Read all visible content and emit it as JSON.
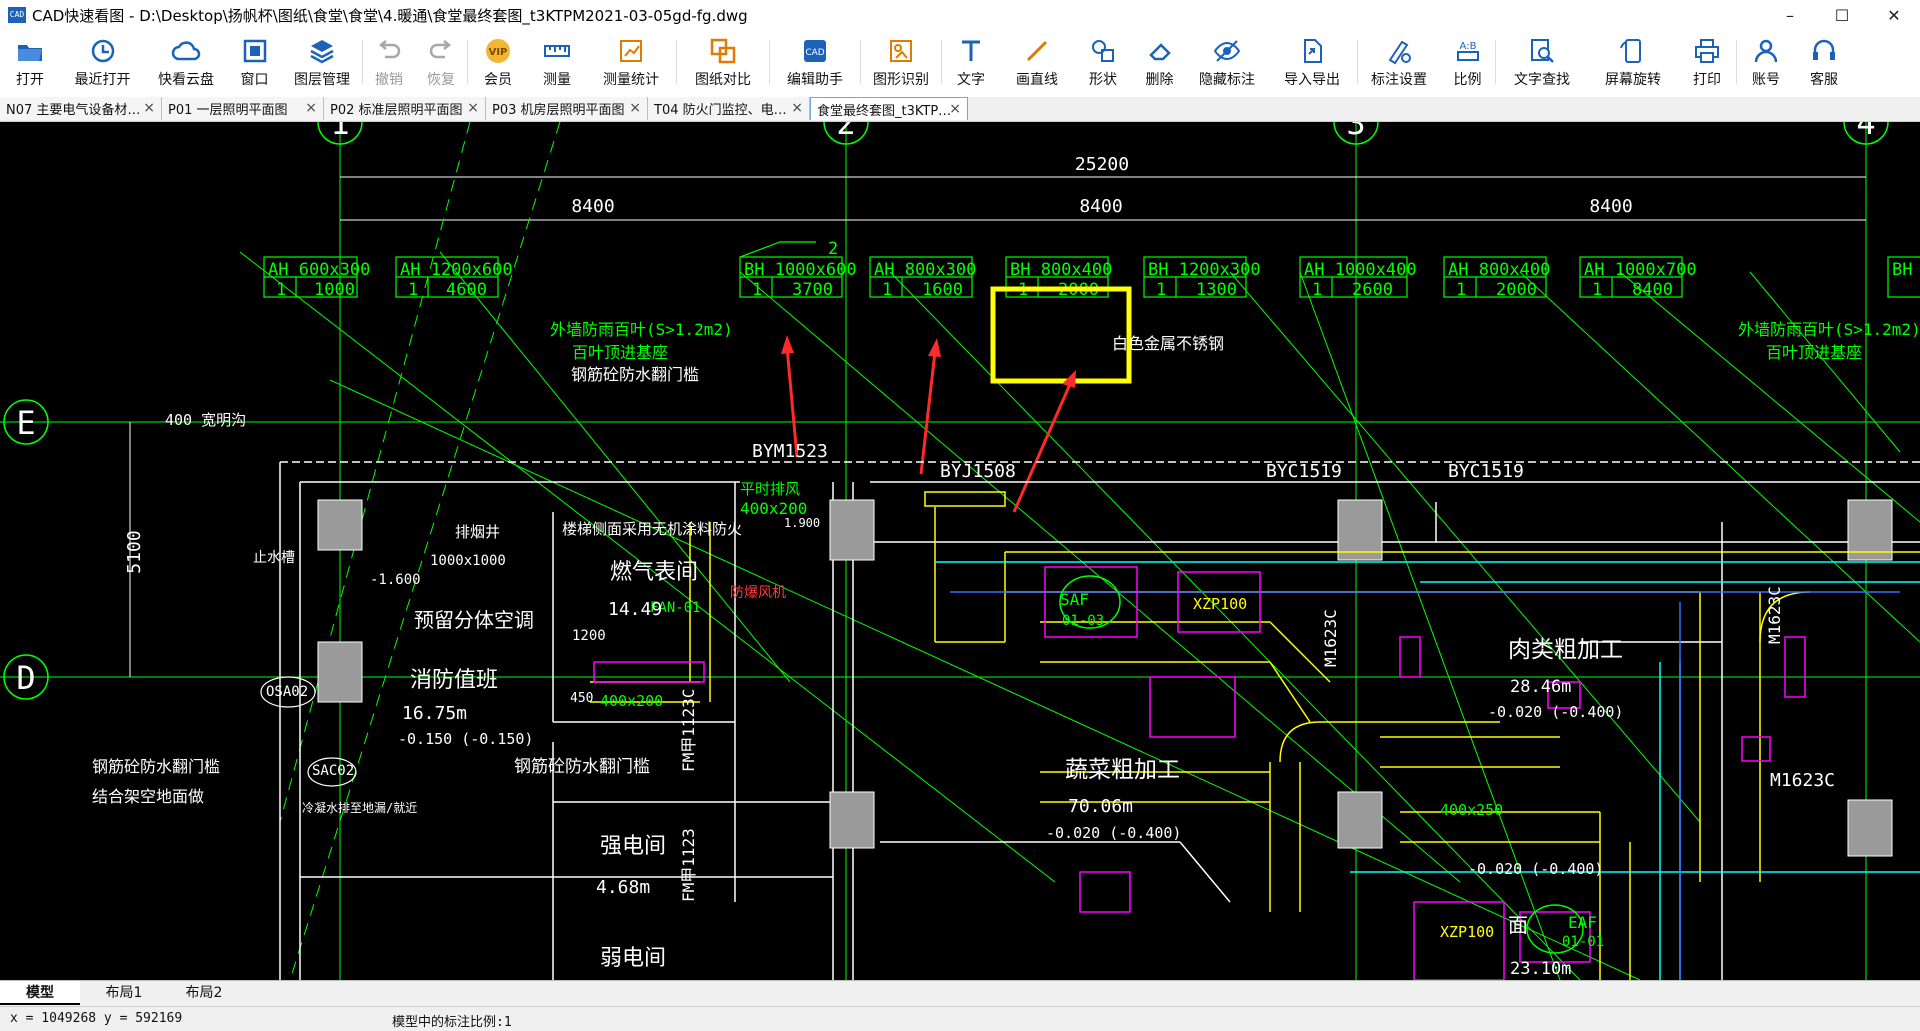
{
  "window": {
    "title": "CAD快速看图 - D:\\Desktop\\扬帆杯\\图纸\\食堂\\食堂\\4.暖通\\食堂最终套图_t3KTPM2021-03-05gd-fg.dwg",
    "app_icon_text": "CAD",
    "minimize": "–",
    "maximize": "☐",
    "close": "✕"
  },
  "toolbar": {
    "items": [
      {
        "label": "打开",
        "icon": "folder-open-icon",
        "enabled": true
      },
      {
        "label": "最近打开",
        "icon": "clock-history-icon",
        "enabled": true
      },
      {
        "label": "快看云盘",
        "icon": "cloud-icon",
        "enabled": true
      },
      {
        "label": "窗口",
        "icon": "window-icon",
        "enabled": true
      },
      {
        "label": "图层管理",
        "icon": "layers-icon",
        "enabled": true
      },
      {
        "label": "撤销",
        "icon": "undo-icon",
        "enabled": false
      },
      {
        "label": "恢复",
        "icon": "redo-icon",
        "enabled": false
      },
      {
        "label": "会员",
        "icon": "vip-icon",
        "enabled": true,
        "badge": "VIP"
      },
      {
        "label": "测量",
        "icon": "ruler-icon",
        "enabled": true
      },
      {
        "label": "测量统计",
        "icon": "measure-stats-icon",
        "enabled": true
      },
      {
        "label": "图纸对比",
        "icon": "compare-icon",
        "enabled": true
      },
      {
        "label": "编辑助手",
        "icon": "edit-assistant-icon",
        "enabled": true
      },
      {
        "label": "图形识别",
        "icon": "shape-recognize-icon",
        "enabled": true
      },
      {
        "label": "文字",
        "icon": "text-icon",
        "enabled": true
      },
      {
        "label": "画直线",
        "icon": "line-icon",
        "enabled": true
      },
      {
        "label": "形状",
        "icon": "shape-icon",
        "enabled": true
      },
      {
        "label": "删除",
        "icon": "eraser-icon",
        "enabled": true
      },
      {
        "label": "隐藏标注",
        "icon": "hide-annotation-icon",
        "enabled": true
      },
      {
        "label": "导入导出",
        "icon": "import-export-icon",
        "enabled": true
      },
      {
        "label": "标注设置",
        "icon": "annotation-settings-icon",
        "enabled": true
      },
      {
        "label": "比例",
        "icon": "scale-icon",
        "enabled": true
      },
      {
        "label": "文字查找",
        "icon": "text-search-icon",
        "enabled": true
      },
      {
        "label": "屏幕旋转",
        "icon": "rotate-screen-icon",
        "enabled": true
      },
      {
        "label": "打印",
        "icon": "printer-icon",
        "enabled": true
      },
      {
        "label": "账号",
        "icon": "account-icon",
        "enabled": true
      },
      {
        "label": "客服",
        "icon": "headset-icon",
        "enabled": true
      }
    ]
  },
  "doc_tabs": [
    {
      "label": "N07 主要电气设备材…",
      "active": false
    },
    {
      "label": "P01 一层照明平面图",
      "active": false
    },
    {
      "label": "P02 标准层照明平面图",
      "active": false
    },
    {
      "label": "P03 机房层照明平面图",
      "active": false
    },
    {
      "label": "T04 防火门监控、电…",
      "active": false
    },
    {
      "label": "食堂最终套图_t3KTP…",
      "active": true
    }
  ],
  "tab_close": "×",
  "drawing": {
    "axes_top": [
      "1",
      "2",
      "3",
      "4"
    ],
    "axes_left": [
      "E",
      "D"
    ],
    "dim_total": "25200",
    "dim_spans": [
      "8400",
      "8400",
      "8400"
    ],
    "dim_vertical": "5100",
    "tag_rows": {
      "top": [
        "AH",
        "BH",
        "AH",
        "AH",
        "BH",
        "BH",
        "AH",
        "AH",
        "AH",
        "BH"
      ]
    },
    "tags": [
      {
        "top": "AH 600x300",
        "bottom_a": "1",
        "bottom_b": "1000"
      },
      {
        "top": "AH 1200x600",
        "bottom_a": "1",
        "bottom_b": "4600"
      },
      {
        "top": "BH 1000x600",
        "bottom_a": "1",
        "bottom_b": "3700"
      },
      {
        "top": "AH 800x300",
        "bottom_a": "1",
        "bottom_b": "1600"
      },
      {
        "top": "BH 800x400",
        "bottom_a": "1",
        "bottom_b": "2000"
      },
      {
        "top": "BH 1200x300",
        "bottom_a": "1",
        "bottom_b": "1300"
      },
      {
        "top": "AH 1000x400",
        "bottom_a": "1",
        "bottom_b": "2600"
      },
      {
        "top": "AH 800x400",
        "bottom_a": "1",
        "bottom_b": "2000"
      },
      {
        "top": "AH 1000x700",
        "bottom_a": "1",
        "bottom_b": "8400"
      },
      {
        "top": "BH",
        "bottom_a": "",
        "bottom_b": ""
      }
    ],
    "tag_index_note": "2",
    "notes": {
      "waterproof_wall_left": "外墙防雨百叶(S>1.2m2)",
      "waterproof_wall_left_2": "百叶顶进基座",
      "waterproof_wall_right": "外墙防雨百叶(S>1.2m2)",
      "waterproof_wall_right_2": "百叶顶进基座",
      "sill": "钢筋砼防水翻门槛",
      "open_ditch": "400 宽明沟",
      "stair_note": "楼梯侧面采用无机涂料防火",
      "shaft": "排烟井",
      "shaft_size": "1000x1000",
      "stop_valve": "止水槽",
      "level_1": "-1.600",
      "reserved_ac": "预留分体空调",
      "fire_room": "消防值班",
      "fire_room_area": "16.75m",
      "fire_room_level": "-0.150  (-0.150)",
      "sill_2": "钢筋砼防水翻门槛",
      "sill_left": "钢筋砼防水翻门槛",
      "frame": "结合架空地面做",
      "drain": "冷凝水排至地漏/就近",
      "gas_room": "燃气表间",
      "gas_area": "14.49",
      "fan_label": "FAN-01",
      "exhaust_fan": "防爆风机",
      "exhaust_label": "平时排风",
      "duct_400": "400x200",
      "duct_400b": "400x200",
      "dim_1200": "1200",
      "dim_450": "450",
      "strong_room": "强电间",
      "strong_area": "4.68m",
      "weak_room": "弱电间",
      "vegetable": "蔬菜粗加工",
      "veg_area": "70.06m",
      "veg_level": "-0.020  (-0.400)",
      "meat": "肉类粗加工",
      "meat_area": "28.46m",
      "meat_level": "-0.020  (-0.400)",
      "veg_level_2": "-0.020  (-0.400)",
      "dim_400x250": "400x250",
      "door_bym": "BYM1523",
      "door_byj": "BYJ1508",
      "door_byc1": "BYC1519",
      "door_byc2": "BYC1519",
      "door_fm1": "FM甲1123C",
      "door_fm2": "FM甲1123",
      "door_m1": "M1623C",
      "door_m2": "M1623C",
      "door_m3": "M1623C",
      "osa": "OSA02",
      "sac": "SAC02",
      "saf": "SAF",
      "saf_id": "01-03",
      "eaf": "EAF",
      "eaf_id": "01-01",
      "xzp1": "XZP100",
      "xzp2": "XZP100",
      "last_area": "23.10m",
      "stainless": "白色金属不锈钢",
      "face": "面",
      "small_1900": "1.900",
      "sq": "2"
    }
  },
  "layout_tabs": [
    {
      "label": "模型",
      "active": true
    },
    {
      "label": "布局1",
      "active": false
    },
    {
      "label": "布局2",
      "active": false
    }
  ],
  "status": {
    "coords": "x = 1049268  y = 592169",
    "scale_text": "模型中的标注比例:1"
  },
  "colors": {
    "canvas_bg": "#000000",
    "annot_green": "#00ff00",
    "wall_white": "#ffffff",
    "duct_yellow": "#ffff00",
    "cyan": "#00ffff",
    "magenta": "#ff00ff",
    "highlight_yellow": "#ffff00",
    "arrow_red": "#ff2a2a",
    "toolbar_blue": "#1c62b9"
  }
}
